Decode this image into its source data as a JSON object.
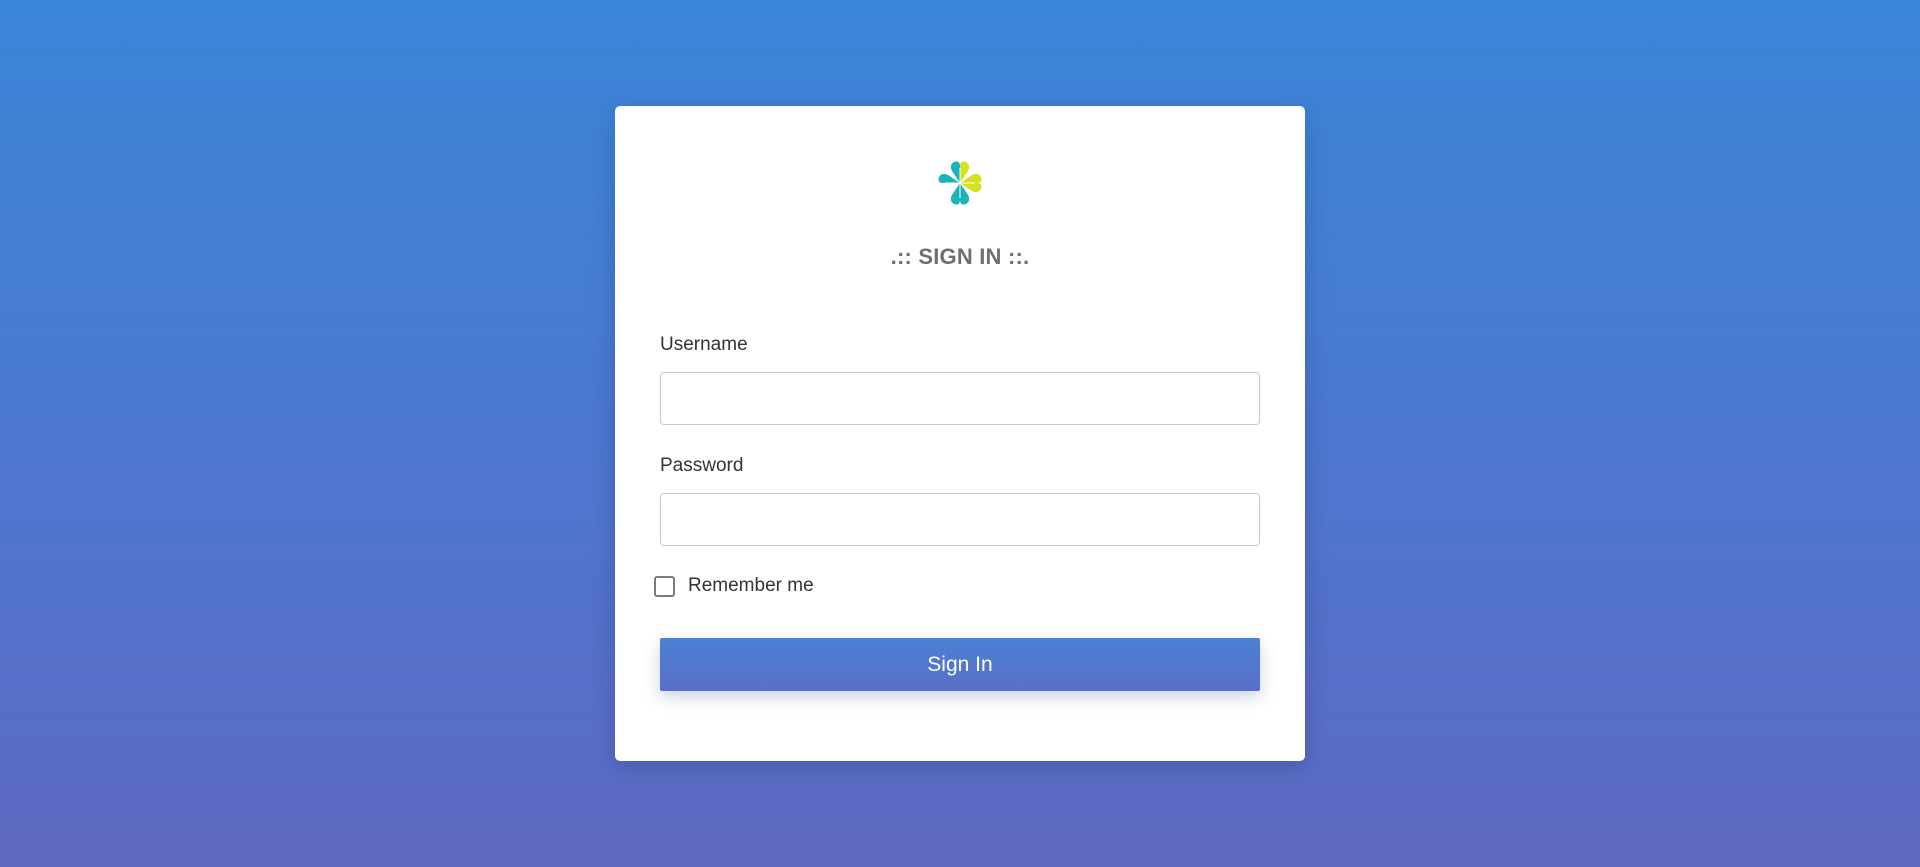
{
  "page": {
    "background_top": "#3b86d8",
    "background_bottom": "#5f69c1"
  },
  "card": {
    "logo": "clover-logo-icon",
    "title": ".:: SIGN IN ::.",
    "username": {
      "label": "Username",
      "value": "",
      "placeholder": ""
    },
    "password": {
      "label": "Password",
      "value": "",
      "placeholder": ""
    },
    "remember": {
      "label": "Remember me",
      "checked": false
    },
    "submit": {
      "label": "Sign In",
      "color": "#4f7bd3"
    }
  },
  "colors": {
    "logo_teal": "#19b3b8",
    "logo_yellow": "#d6e21f",
    "title": "#6f6f6f"
  }
}
